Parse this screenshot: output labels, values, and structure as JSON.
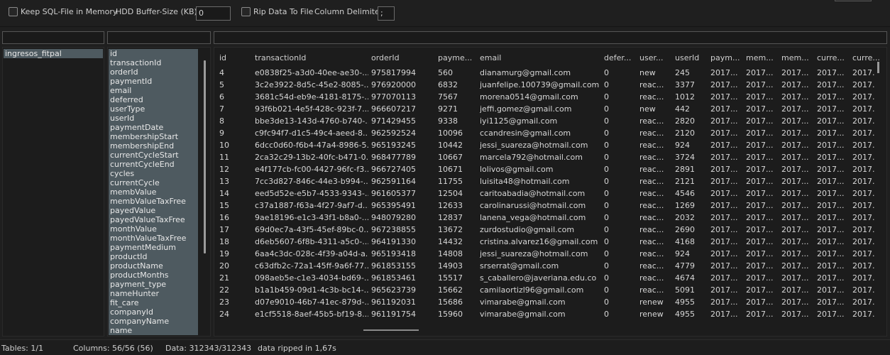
{
  "toolbar": {
    "keep_sql_label": "Keep SQL-File in Memory",
    "hdd_buffer_label": "HDD Buffer-Size (KB):",
    "hdd_buffer_value": "0",
    "rip_label": "Rip Data To File",
    "delimiter_label": "Column Delimiter:",
    "delimiter_value": ";"
  },
  "tables": [
    "ingresos_fitpal"
  ],
  "columns": [
    "id",
    "transactionId",
    "orderId",
    "paymentId",
    "email",
    "deferred",
    "userType",
    "userId",
    "paymentDate",
    "membershipStart",
    "membershipEnd",
    "currentCycleStart",
    "currentCycleEnd",
    "cycles",
    "currentCycle",
    "membValue",
    "membValueTaxFree",
    "payedValue",
    "payedValueTaxFree",
    "monthValue",
    "monthValueTaxFree",
    "paymentMedium",
    "productId",
    "productName",
    "productMonths",
    "payment_type",
    "nameHunter",
    "fit_care",
    "companyId",
    "companyName",
    "name"
  ],
  "grid": {
    "headers": [
      "id",
      "transactionId",
      "orderId",
      "payme...",
      "email",
      "defer...",
      "user...",
      "userId",
      "paym...",
      "mem...",
      "mem...",
      "curre...",
      "curre..."
    ],
    "rows": [
      [
        "4",
        "e0838f25-a3d0-40ee-ae30-...",
        "975817994",
        "560",
        "dianamurg@gmail.com",
        "0",
        "new",
        "245",
        "2017...",
        "2017...",
        "2017...",
        "2017...",
        "2017."
      ],
      [
        "5",
        "3c2e3922-8d5c-45e2-8085-...",
        "976920000",
        "6832",
        "juanfelipe.100739@gmail.com",
        "0",
        "reac...",
        "3377",
        "2017...",
        "2017...",
        "2017...",
        "2017...",
        "2017."
      ],
      [
        "6",
        "3681c54d-eb9e-4181-8175-...",
        "977070113",
        "7567",
        "morena0514@gmail.com",
        "0",
        "reac...",
        "1012",
        "2017...",
        "2017...",
        "2017...",
        "2017...",
        "2017."
      ],
      [
        "7",
        "93f6b021-4e5f-428c-923f-7...",
        "966607217",
        "9271",
        "jeffi.gomez@gmail.com",
        "0",
        "new",
        "442",
        "2017...",
        "2017...",
        "2017...",
        "2017...",
        "2017."
      ],
      [
        "8",
        "bbe3de13-143d-4760-b740-...",
        "971429455",
        "9338",
        "iyi1125@gmail.com",
        "0",
        "reac...",
        "2820",
        "2017...",
        "2017...",
        "2017...",
        "2017...",
        "2017."
      ],
      [
        "9",
        "c9fc94f7-d1c5-49c4-aeed-8...",
        "962592524",
        "10096",
        "ccandresin@gmail.com",
        "0",
        "reac...",
        "2120",
        "2017...",
        "2017...",
        "2017...",
        "2017...",
        "2017."
      ],
      [
        "10",
        "6dcc0d60-f6b4-47a4-8986-5...",
        "965193245",
        "10442",
        "jessi_suareza@hotmail.com",
        "0",
        "reac...",
        "924",
        "2017...",
        "2017...",
        "2017...",
        "2017...",
        "2017."
      ],
      [
        "11",
        "2ca32c29-13b2-40fc-b471-0...",
        "968477789",
        "10667",
        "marcela792@hotmail.com",
        "0",
        "reac...",
        "3724",
        "2017...",
        "2017...",
        "2017...",
        "2017...",
        "2017."
      ],
      [
        "12",
        "e4f177cb-fc00-4427-96fc-f3...",
        "966727405",
        "10671",
        "lolivos@gmail.com",
        "0",
        "reac...",
        "2891",
        "2017...",
        "2017...",
        "2017...",
        "2017...",
        "2017."
      ],
      [
        "13",
        "7cc3d827-846c-44e3-b994-...",
        "962591164",
        "11755",
        "luisita48@hotmail.com",
        "0",
        "reac...",
        "2121",
        "2017...",
        "2017...",
        "2017...",
        "2017...",
        "2017."
      ],
      [
        "14",
        "eed5d52e-e5b7-4533-9343-...",
        "961605377",
        "12504",
        "caritoabadia@hotmail.com",
        "0",
        "reac...",
        "4546",
        "2017...",
        "2017...",
        "2017...",
        "2017...",
        "2017."
      ],
      [
        "15",
        "c37a1887-f63a-4f27-9af7-d...",
        "965395491",
        "12633",
        "carolinarussi@hotmail.com",
        "0",
        "reac...",
        "1269",
        "2017...",
        "2017...",
        "2017...",
        "2017...",
        "2017."
      ],
      [
        "16",
        "9ae18196-e1c3-43f1-b8a0-...",
        "948079280",
        "12837",
        "lanena_vega@hotmail.com",
        "0",
        "reac...",
        "2032",
        "2017...",
        "2017...",
        "2017...",
        "2017...",
        "2017."
      ],
      [
        "17",
        "69d0ec7a-43f5-45ef-89bc-0...",
        "967238855",
        "13672",
        "zurdostudio@gmail.com",
        "0",
        "reac...",
        "2690",
        "2017...",
        "2017...",
        "2017...",
        "2017...",
        "2017."
      ],
      [
        "18",
        "d6eb5607-6f8b-4311-a5c0-...",
        "964191330",
        "14432",
        "cristina.alvarez16@gmail.com",
        "0",
        "reac...",
        "4168",
        "2017...",
        "2017...",
        "2017...",
        "2017...",
        "2017."
      ],
      [
        "19",
        "6aa4c3dc-028c-4f39-a04d-a...",
        "965193418",
        "14808",
        "jessi_suareza@hotmail.com",
        "0",
        "reac...",
        "924",
        "2017...",
        "2017...",
        "2017...",
        "2017...",
        "2017."
      ],
      [
        "20",
        "c63dfb2c-72a1-45ff-9a6f-77...",
        "961853155",
        "14903",
        "srserrat@gmail.com",
        "0",
        "reac...",
        "4779",
        "2017...",
        "2017...",
        "2017...",
        "2017...",
        "2017."
      ],
      [
        "21",
        "098aeb5e-c1e3-4034-bd69-...",
        "961853461",
        "15517",
        "s_caballero@javeriana.edu.co",
        "0",
        "reac...",
        "4674",
        "2017...",
        "2017...",
        "2017...",
        "2017...",
        "2017."
      ],
      [
        "22",
        "b1a1b459-09d1-4c3b-bc14-...",
        "965623739",
        "15662",
        "camilaortizl96@gmail.com",
        "0",
        "reac...",
        "5091",
        "2017...",
        "2017...",
        "2017...",
        "2017...",
        "2017."
      ],
      [
        "23",
        "d07e9010-46b7-41ec-879d-...",
        "961192031",
        "15686",
        "vimarabe@gmail.com",
        "0",
        "renew",
        "4955",
        "2017...",
        "2017...",
        "2017...",
        "2017...",
        "2017."
      ],
      [
        "24",
        "e1cf5518-8aef-45b5-bf19-8...",
        "961191754",
        "15960",
        "vimarabe@gmail.com",
        "0",
        "renew",
        "4955",
        "2017...",
        "2017...",
        "2017...",
        "2017...",
        "2017."
      ]
    ]
  },
  "status": {
    "tables": "Tables: 1/1",
    "columns": "Columns: 56/56 (56)",
    "data": "Data: 312343/312343",
    "message": "data ripped in 1,67s"
  }
}
